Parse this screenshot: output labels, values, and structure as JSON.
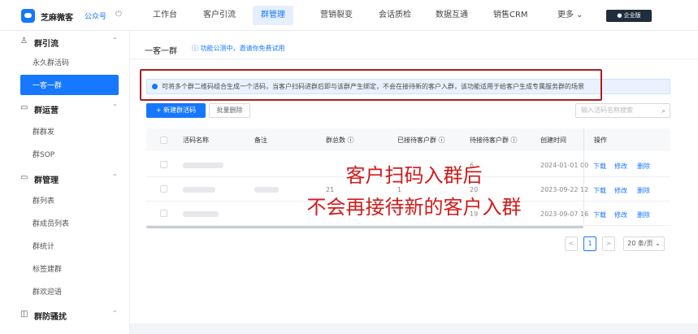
{
  "topbar": {
    "brand": "芝麻微客",
    "account_link": "公众号",
    "nav": [
      "工作台",
      "客户引流",
      "群管理",
      "营销裂变",
      "会话质检",
      "数据互通",
      "销售CRM",
      "更多 ⌄"
    ],
    "active_nav": "群管理",
    "enterprise_button": "● 企业版"
  },
  "sidebar": {
    "groups": [
      {
        "label": "群引流",
        "items": [
          "永久群活码",
          "一客一群"
        ]
      },
      {
        "label": "群运营",
        "items": [
          "群群发",
          "群SOP"
        ]
      },
      {
        "label": "群管理",
        "items": [
          "群列表",
          "群成员列表",
          "群统计",
          "标签建群",
          "群欢迎语"
        ]
      },
      {
        "label": "群防骚扰",
        "items": []
      }
    ],
    "active_item": "一客一群"
  },
  "header": {
    "title": "一客一群",
    "beta_notice": "ⓘ 功能公测中，邀请你免费试用"
  },
  "notice": "可将多个群二维码组合生成一个活码，当客户扫码进群后即与该群产生绑定，不会在接待新的客户入群，该功能适用于给客户生成专属服务群的场景",
  "toolbar": {
    "new_button": "+ 新建群活码",
    "batch_delete": "批量删除",
    "search_placeholder": "输入活码名称搜索"
  },
  "table": {
    "columns": [
      "活码名称",
      "备注",
      "群总数 ⓘ",
      "已接待客户群 ⓘ",
      "待接待客户群 ⓘ",
      "创建时间",
      "操作"
    ],
    "rows": [
      {
        "total": "",
        "received": "",
        "pending": "6",
        "created": "2024-01-01 00",
        "actions": [
          "下载",
          "修改",
          "删除"
        ]
      },
      {
        "total": "21",
        "received": "1",
        "pending": "20",
        "created": "2023-09-22 12",
        "actions": [
          "下载",
          "修改",
          "删除"
        ]
      },
      {
        "total": "",
        "received": "",
        "pending": "19",
        "created": "2023-09-07 16",
        "actions": [
          "下载",
          "修改",
          "删除"
        ]
      }
    ]
  },
  "overlay_text": {
    "line1": "客户扫码入群后",
    "line2": "不会再接待新的客户入群"
  },
  "pagination": {
    "prev": "<",
    "current": "1",
    "next": ">",
    "page_size": "20 条/页 ⌄"
  },
  "colors": {
    "accent": "#1677ff",
    "annotation_red": "#d11b1b"
  }
}
